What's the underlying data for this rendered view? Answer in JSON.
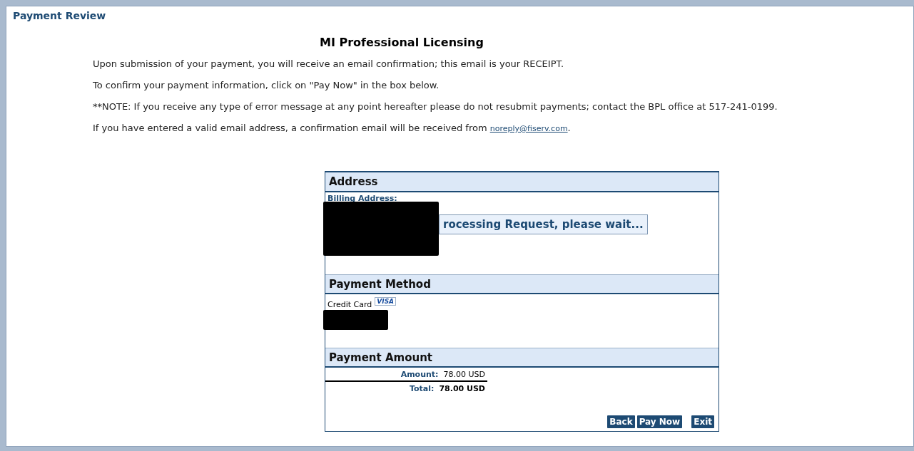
{
  "page_title": "Payment Review",
  "heading": "MI Professional Licensing",
  "notes": [
    "Upon submission of your payment, you will receive an email confirmation; this email is your RECEIPT.",
    "To confirm your payment information, click on \"Pay Now\" in the box below.",
    "**NOTE: If you receive any type of error message at any point hereafter please do not resubmit payments; contact the BPL office at 517-241-0199."
  ],
  "email_note": {
    "text": "If you have entered a valid email address, a confirmation email will be received from ",
    "link": "noreply@fiserv.com",
    "after": "."
  },
  "address": {
    "header": "Address",
    "label": "Billing Address:",
    "loading": "rocessing Request, please wait..."
  },
  "payment_method": {
    "header": "Payment Method",
    "card_type": "Credit Card",
    "card_logo": "VISA"
  },
  "payment_amount": {
    "header": "Payment Amount",
    "rows": [
      {
        "label": "Amount:",
        "value": "78.00 USD",
        "kind": "subtotal"
      },
      {
        "label": "Total:",
        "value": "78.00 USD",
        "kind": "total"
      }
    ]
  },
  "buttons": [
    "Back",
    "Pay Now",
    "Exit"
  ]
}
